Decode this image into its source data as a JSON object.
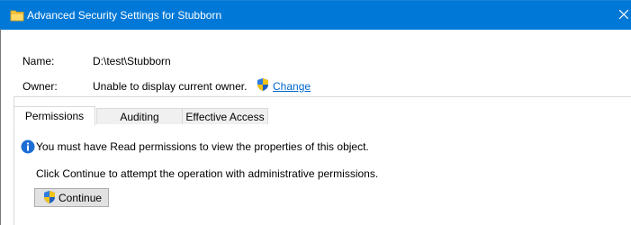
{
  "window": {
    "title": "Advanced Security Settings for Stubborn",
    "titlebar_color": "#0078d7",
    "icon": "folder-icon",
    "close_icon": "close-icon"
  },
  "name_row": {
    "label": "Name:",
    "value": "D:\\test\\Stubborn"
  },
  "owner_row": {
    "label": "Owner:",
    "value": "Unable to display current owner.",
    "link_icon": "shield-icon",
    "link_label": "Change",
    "link_color": "#0066cc"
  },
  "tabs": [
    {
      "label": "Permissions",
      "active": true
    },
    {
      "label": "Auditing",
      "active": false
    },
    {
      "label": "Effective Access",
      "active": false
    }
  ],
  "panel": {
    "info_icon": "info-icon",
    "info_icon_color": "#1c6ed5",
    "info_message": "You must have Read permissions to view the properties of this object.",
    "instruction": "Click Continue to attempt the operation with administrative permissions.",
    "continue_button": {
      "label": "Continue",
      "icon": "shield-icon"
    }
  }
}
